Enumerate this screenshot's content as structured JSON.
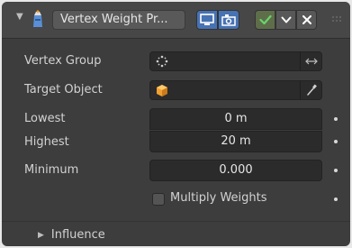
{
  "header": {
    "name": "Vertex Weight Pr...",
    "icons": {
      "collapse": "collapse-arrow-icon",
      "modifier": "vertex-weight-modifier-icon",
      "display": "monitor-icon",
      "render": "camera-icon",
      "apply": "checkmark-icon",
      "dropdown": "chevron-down-icon",
      "delete": "close-icon",
      "grip": "drag-grip-icon"
    }
  },
  "fields": {
    "vertex_group": {
      "label": "Vertex Group",
      "icon": "vertex-group-icon",
      "swap_icon": "swap-arrows-icon"
    },
    "target_object": {
      "label": "Target Object",
      "icon": "object-icon",
      "picker_icon": "eyedropper-icon"
    },
    "lowest": {
      "label": "Lowest",
      "value": "0 m"
    },
    "highest": {
      "label": "Highest",
      "value": "20 m"
    },
    "minimum": {
      "label": "Minimum",
      "value": "0.000"
    },
    "multiply_weights": {
      "label": "Multiply Weights",
      "checked": false
    }
  },
  "subpanel": {
    "label": "Influence",
    "icon": "expand-arrow-icon"
  },
  "colors": {
    "panel_bg": "#3d3d3d",
    "header_bg": "#474747",
    "field_bg": "#2b2b2b",
    "accent_blue": "#4772b3",
    "apply_green": "#5e6e4a",
    "check_green": "#6bd36b"
  }
}
